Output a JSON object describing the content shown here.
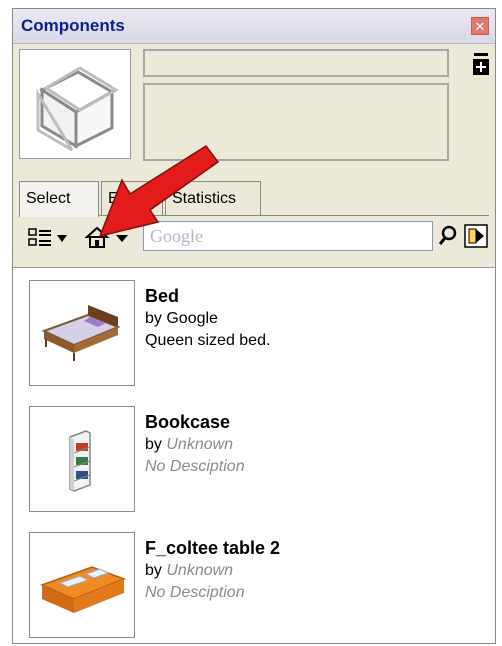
{
  "window": {
    "title": "Components",
    "close_label": "✕"
  },
  "tabs": [
    {
      "label": "Select"
    },
    {
      "label": "Edit"
    },
    {
      "label": "Statistics"
    }
  ],
  "search": {
    "placeholder": "Google"
  },
  "items": [
    {
      "name": "Bed",
      "by": "by",
      "author": "Google",
      "description": "Queen sized bed."
    },
    {
      "name": "Bookcase",
      "by": "by",
      "author": "Unknown",
      "description": "No Desciption"
    },
    {
      "name": "F_coltee table 2",
      "by": "by",
      "author": "Unknown",
      "description": "No Desciption"
    }
  ],
  "colors": {
    "title": "#0b1f8a",
    "annotation_arrow": "#e21b1b",
    "close": "#e07a6a"
  }
}
